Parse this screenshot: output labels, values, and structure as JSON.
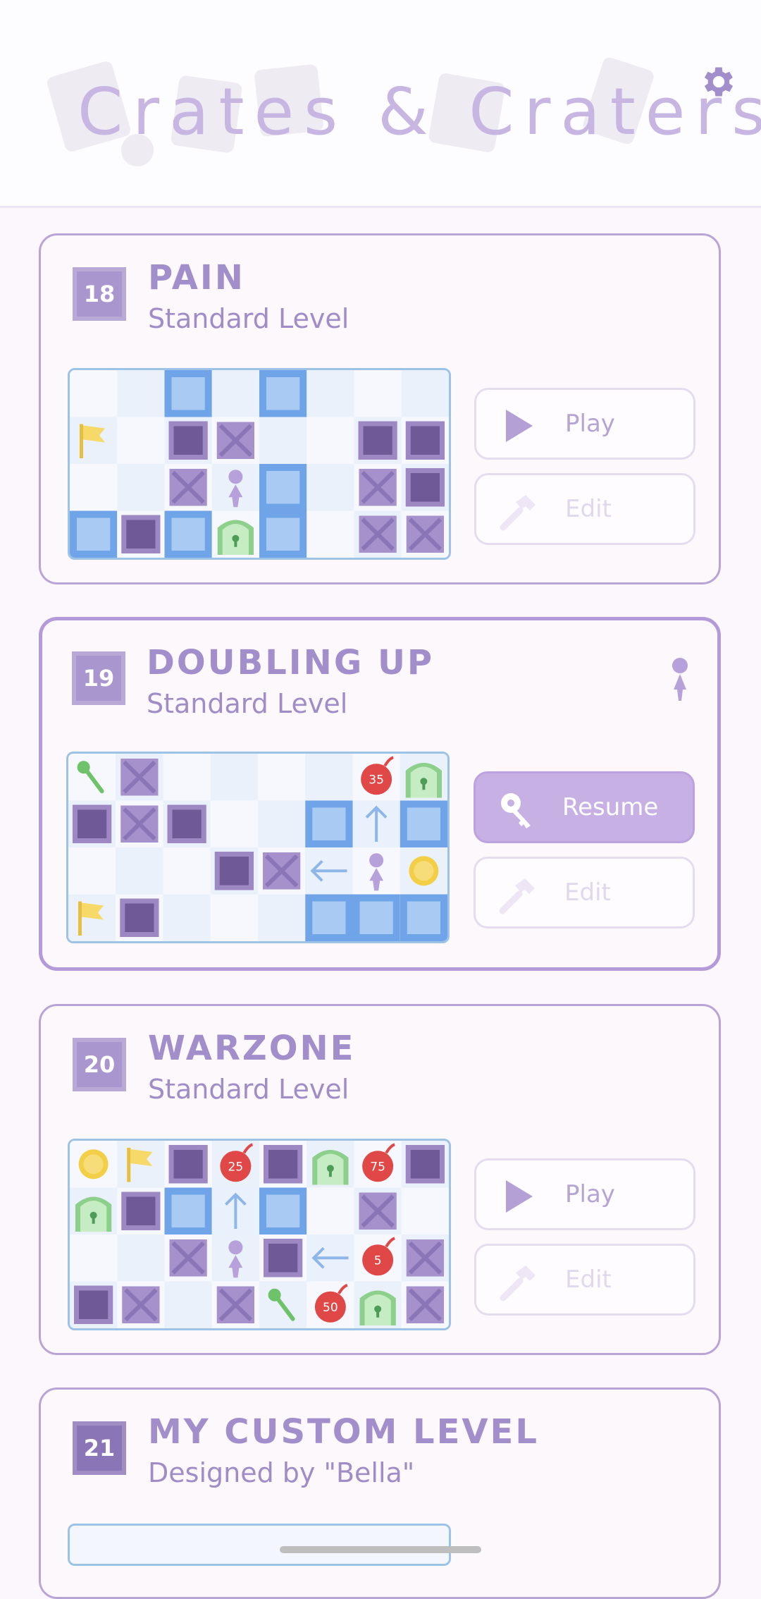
{
  "app": {
    "title": "Crates & Craters"
  },
  "levels": [
    {
      "number": "18",
      "title": "PAIN",
      "subtitle": "Standard Level",
      "primary_label": "Play",
      "primary_icon": "play-icon",
      "edit_label": "Edit",
      "edit_icon": "hammer-icon",
      "grid": {
        "cols": 8,
        "rows": 4,
        "cells": [
          "",
          "",
          "water",
          "",
          "water",
          "",
          "",
          "",
          "flag",
          "",
          "block",
          "crate",
          "",
          "",
          "block",
          "block",
          "",
          "",
          "crate",
          "player",
          "water",
          "",
          "crate",
          "block",
          "water",
          "block",
          "water",
          "door",
          "water",
          "",
          "crate",
          "crate"
        ]
      }
    },
    {
      "number": "19",
      "title": "DOUBLING UP",
      "subtitle": "Standard Level",
      "in_progress": true,
      "primary_label": "Resume",
      "primary_icon": "key-icon",
      "edit_label": "Edit",
      "edit_icon": "hammer-icon",
      "grid": {
        "cols": 8,
        "rows": 4,
        "cells": [
          "key",
          "crate",
          "",
          "",
          "",
          "",
          "bomb:35",
          "door",
          "block",
          "crate",
          "block",
          "",
          "",
          "water",
          "arrow-up",
          "water",
          "",
          "",
          "",
          "block",
          "crate",
          "arrow-left",
          "player",
          "coin",
          "flag",
          "block",
          "",
          "",
          "",
          "water",
          "water",
          "water"
        ]
      }
    },
    {
      "number": "20",
      "title": "WARZONE",
      "subtitle": "Standard Level",
      "primary_label": "Play",
      "primary_icon": "play-icon",
      "edit_label": "Edit",
      "edit_icon": "hammer-icon",
      "grid": {
        "cols": 8,
        "rows": 4,
        "cells": [
          "coin",
          "flag",
          "block",
          "bomb:25",
          "block",
          "door",
          "bomb:75",
          "block",
          "door",
          "block",
          "water",
          "arrow-up",
          "water",
          "",
          "crate",
          "",
          "",
          "",
          "crate",
          "player",
          "block",
          "arrow-left",
          "bomb:5",
          "crate",
          "block",
          "crate",
          "",
          "crate",
          "key",
          "bomb:50",
          "door",
          "crate"
        ]
      }
    },
    {
      "number": "21",
      "title": "MY CUSTOM LEVEL",
      "subtitle": "Designed by \"Bella\""
    }
  ],
  "colors": {
    "accent": "#a28ecb",
    "card_border": "#b9a4d6",
    "water": "#6fa4e8",
    "crate": "#9d88c4",
    "bomb": "#e04848",
    "coin": "#f2cf47",
    "door": "#8cd08c"
  }
}
